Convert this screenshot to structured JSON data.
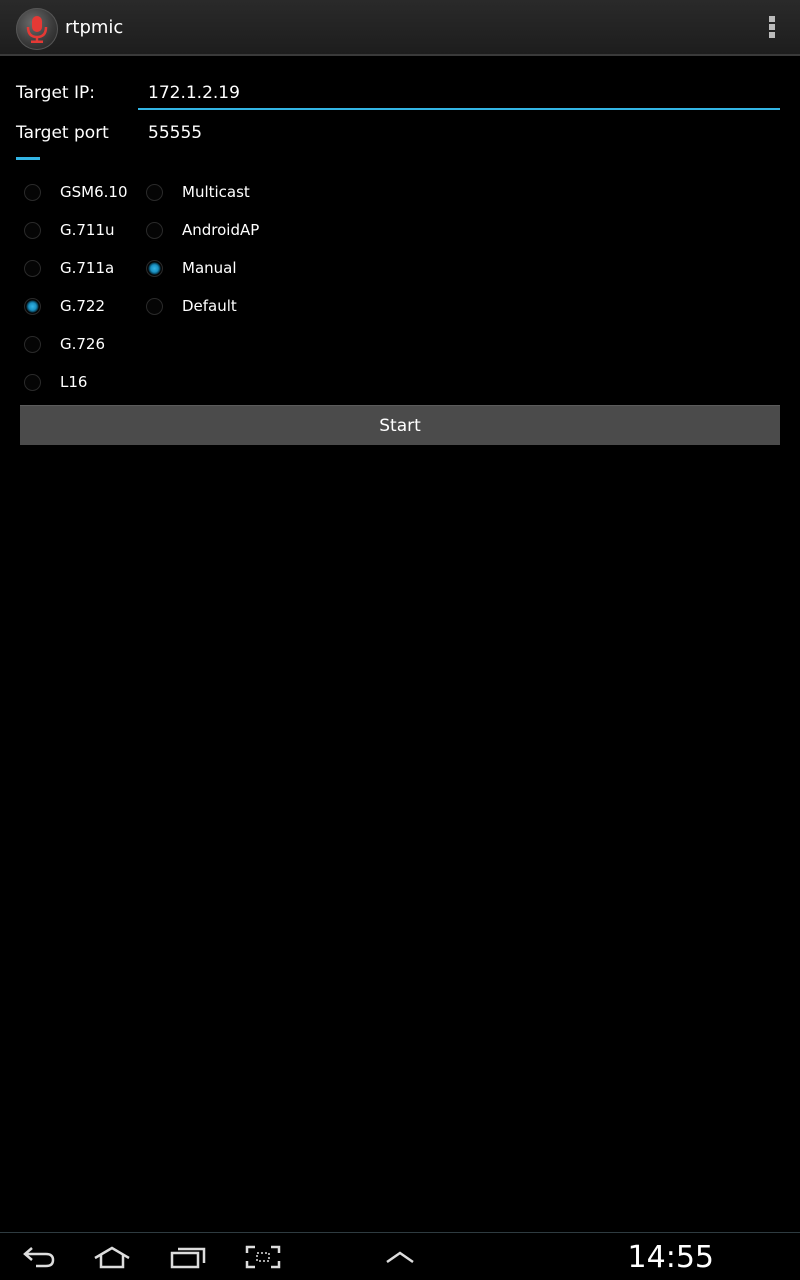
{
  "actionbar": {
    "title": "rtpmic",
    "icon": "microphone-icon",
    "overflow_icon": "overflow-menu-icon"
  },
  "form": {
    "target_ip_label": "Target IP:",
    "target_ip_value": "172.1.2.19",
    "target_port_label": "Target port",
    "target_port_value": "55555"
  },
  "codecs": [
    {
      "label": "GSM6.10",
      "checked": false
    },
    {
      "label": "G.711u",
      "checked": false
    },
    {
      "label": "G.711a",
      "checked": false
    },
    {
      "label": "G.722",
      "checked": true
    },
    {
      "label": "G.726",
      "checked": false
    },
    {
      "label": "L16",
      "checked": false
    }
  ],
  "modes": [
    {
      "label": "Multicast",
      "checked": false
    },
    {
      "label": "AndroidAP",
      "checked": false
    },
    {
      "label": "Manual",
      "checked": true
    },
    {
      "label": "Default",
      "checked": false
    }
  ],
  "start_button": "Start",
  "navbar": {
    "icons": [
      "back-icon",
      "home-icon",
      "recent-apps-icon",
      "screenshot-icon",
      "up-arrow-icon"
    ],
    "time": "14:55"
  },
  "colors": {
    "accent": "#33b5e5",
    "mic_red": "#e53935"
  }
}
